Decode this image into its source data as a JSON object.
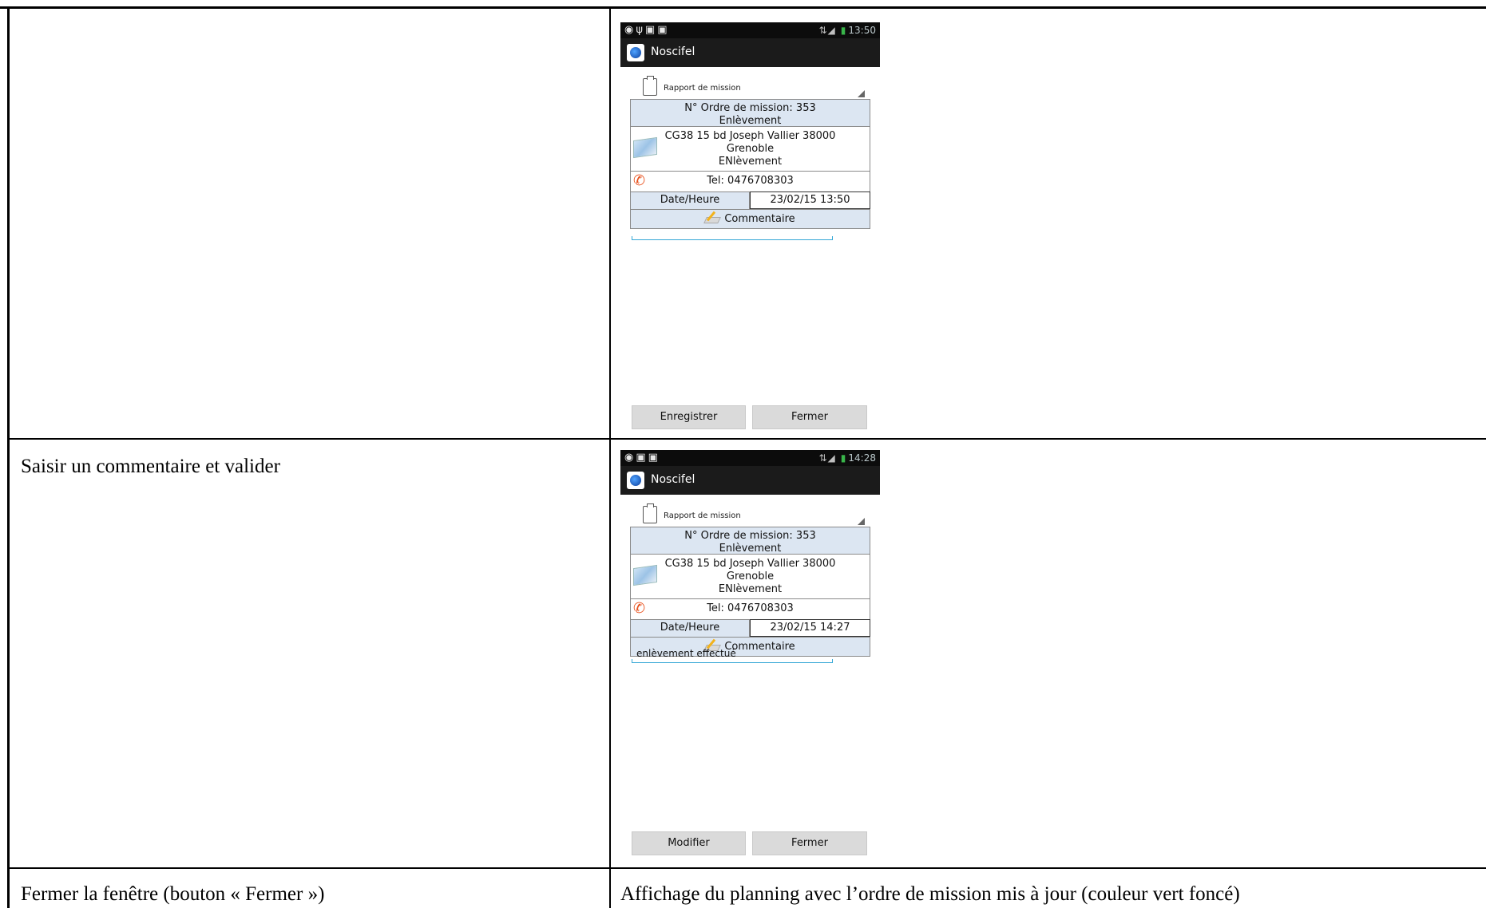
{
  "rows": [
    {
      "instruction": "",
      "phone": {
        "status_time": "13:50",
        "app_title": "Noscifel",
        "spinner_label": "Rapport de mission",
        "ordre_line1": "N° Ordre de mission: 353",
        "ordre_line2": "Enlèvement",
        "address_line1": "CG38 15 bd Joseph Vallier 38000",
        "address_line2": "Grenoble",
        "address_line3": "ENlèvement",
        "tel": "Tel: 0476708303",
        "date_label": "Date/Heure",
        "date_value": "23/02/15 13:50",
        "comment_header": "Commentaire",
        "comment_value": "",
        "button_left": "Enregistrer",
        "button_right": "Fermer"
      }
    },
    {
      "instruction": "Saisir un commentaire et valider",
      "phone": {
        "status_time": "14:28",
        "app_title": "Noscifel",
        "spinner_label": "Rapport de mission",
        "ordre_line1": "N° Ordre de mission: 353",
        "ordre_line2": "Enlèvement",
        "address_line1": "CG38 15 bd Joseph Vallier 38000",
        "address_line2": "Grenoble",
        "address_line3": "ENlèvement",
        "tel": "Tel: 0476708303",
        "date_label": "Date/Heure",
        "date_value": "23/02/15 14:27",
        "comment_header": "Commentaire",
        "comment_value": "enlèvement effectué",
        "button_left": "Modifier",
        "button_right": "Fermer"
      }
    },
    {
      "instruction": "Fermer la fenêtre (bouton « Fermer »)",
      "result": "Affichage du planning avec l’ordre de mission mis à jour (couleur vert foncé)"
    }
  ],
  "colors": {
    "header_blue": "#dce6f2",
    "input_underline": "#35a7d6",
    "action_bar": "#1b1b1b",
    "button_grey": "#dadada"
  }
}
